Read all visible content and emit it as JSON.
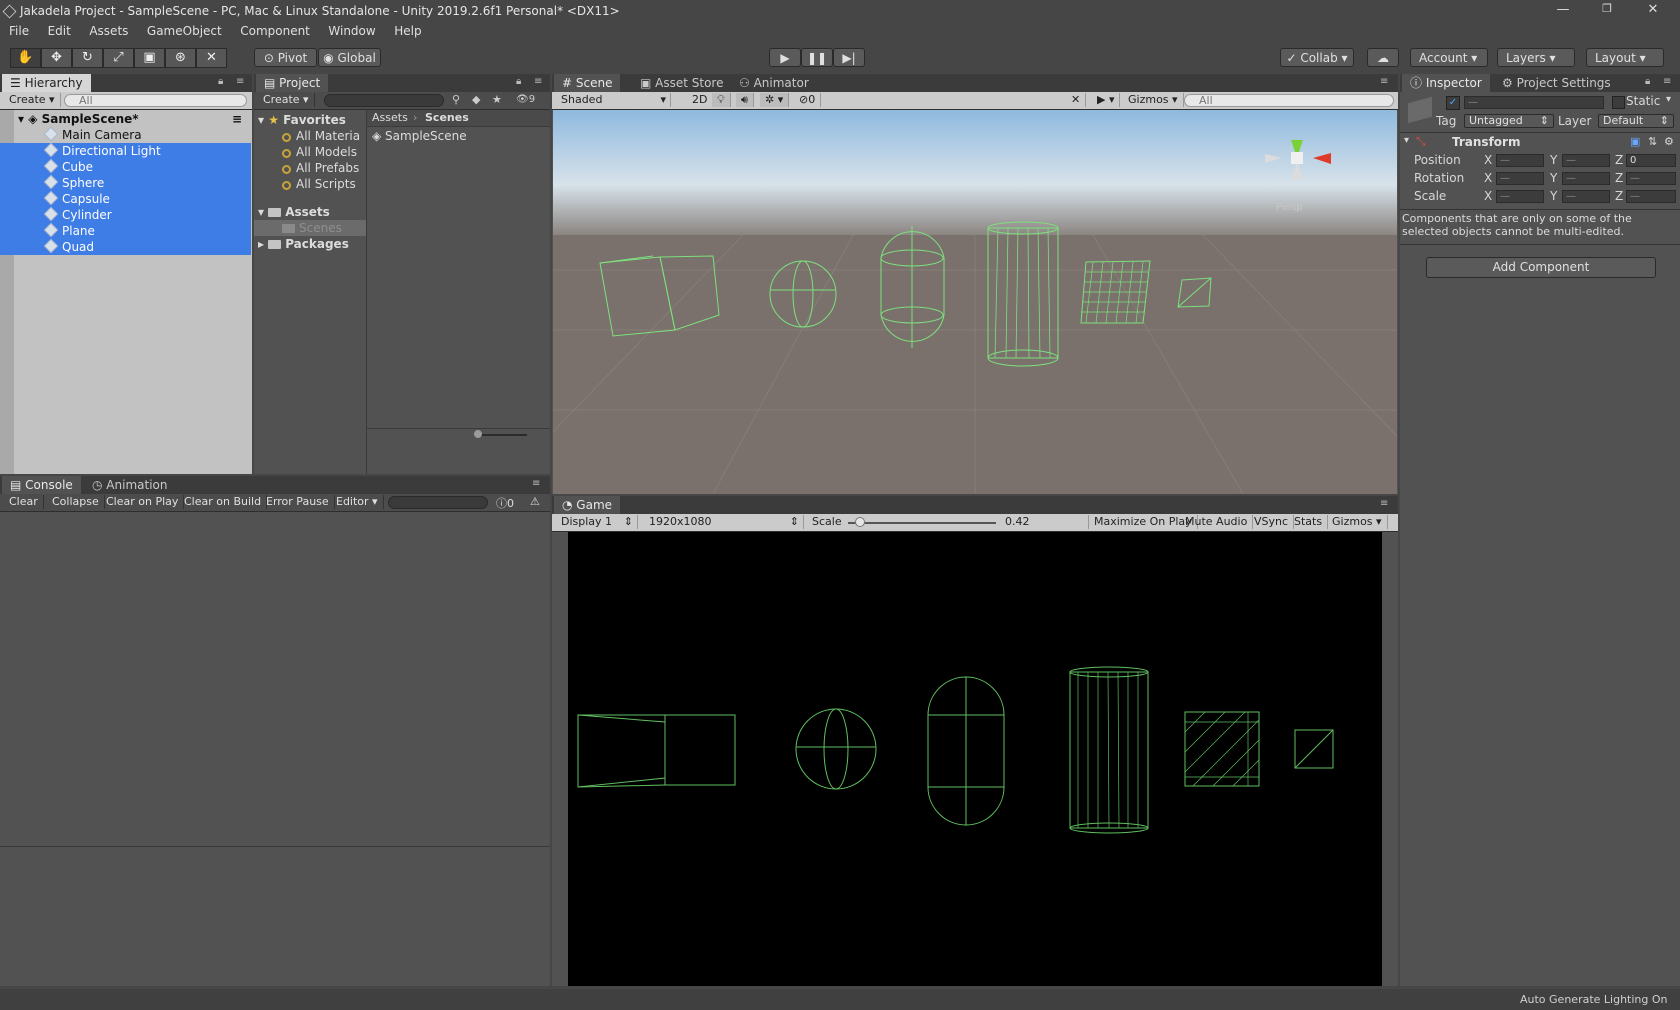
{
  "window": {
    "title": "Jakadela Project - SampleScene - PC, Mac & Linux Standalone - Unity 2019.2.6f1 Personal* <DX11>"
  },
  "menu": [
    "File",
    "Edit",
    "Assets",
    "GameObject",
    "Component",
    "Window",
    "Help"
  ],
  "toolbar": {
    "pivot": "Pivot",
    "global": "Global",
    "collab": "Collab",
    "account": "Account",
    "layers": "Layers",
    "layout": "Layout"
  },
  "hierarchy": {
    "tab": "Hierarchy",
    "create": "Create",
    "search_placeholder": "All",
    "scene": "SampleScene*",
    "items": [
      {
        "label": "Main Camera",
        "selected": false
      },
      {
        "label": "Directional Light",
        "selected": true
      },
      {
        "label": "Cube",
        "selected": true
      },
      {
        "label": "Sphere",
        "selected": true
      },
      {
        "label": "Capsule",
        "selected": true
      },
      {
        "label": "Cylinder",
        "selected": true
      },
      {
        "label": "Plane",
        "selected": true
      },
      {
        "label": "Quad",
        "selected": true
      }
    ]
  },
  "project": {
    "tab": "Project",
    "create": "Create",
    "badge": "9",
    "favorites": "Favorites",
    "fav_items": [
      "All Materia",
      "All Models",
      "All Prefabs",
      "All Scripts"
    ],
    "assets": "Assets",
    "scenes_folder": "Scenes",
    "packages": "Packages",
    "breadcrumb": [
      "Assets",
      "Scenes"
    ],
    "content": [
      "SampleScene"
    ]
  },
  "console": {
    "tab": "Console",
    "tab2": "Animation",
    "buttons": [
      "Clear",
      "Collapse",
      "Clear on Play",
      "Clear on Build",
      "Error Pause",
      "Editor"
    ],
    "count": "0"
  },
  "scene": {
    "tabs": [
      "Scene",
      "Asset Store",
      "Animator"
    ],
    "shading": "Shaded",
    "mode2d": "2D",
    "hidden": "0",
    "gizmos": "Gizmos",
    "search_placeholder": "All",
    "persp": "Persp"
  },
  "game": {
    "tab": "Game",
    "display": "Display 1",
    "resolution": "1920x1080",
    "scale_label": "Scale",
    "scale_value": "0.42",
    "scale_fraction": 0.05,
    "buttons": [
      "Maximize On Play",
      "Mute Audio",
      "VSync",
      "Stats",
      "Gizmos"
    ]
  },
  "inspector": {
    "tab": "Inspector",
    "tab2": "Project Settings",
    "static": "Static",
    "tag_label": "Tag",
    "tag": "Untagged",
    "layer_label": "Layer",
    "layer": "Default",
    "name_value": "—",
    "transform": "Transform",
    "rows": [
      {
        "label": "Position",
        "x": "—",
        "y": "—",
        "z": "0"
      },
      {
        "label": "Rotation",
        "x": "—",
        "y": "—",
        "z": "—"
      },
      {
        "label": "Scale",
        "x": "—",
        "y": "—",
        "z": "—"
      }
    ],
    "note": "Components that are only on some of the selected objects cannot be multi-edited.",
    "add_component": "Add Component"
  },
  "status": {
    "text": "Auto Generate Lighting On"
  },
  "colors": {
    "selection": "#3e7ce6",
    "wire": "#7de07d",
    "panel": "#525252"
  }
}
